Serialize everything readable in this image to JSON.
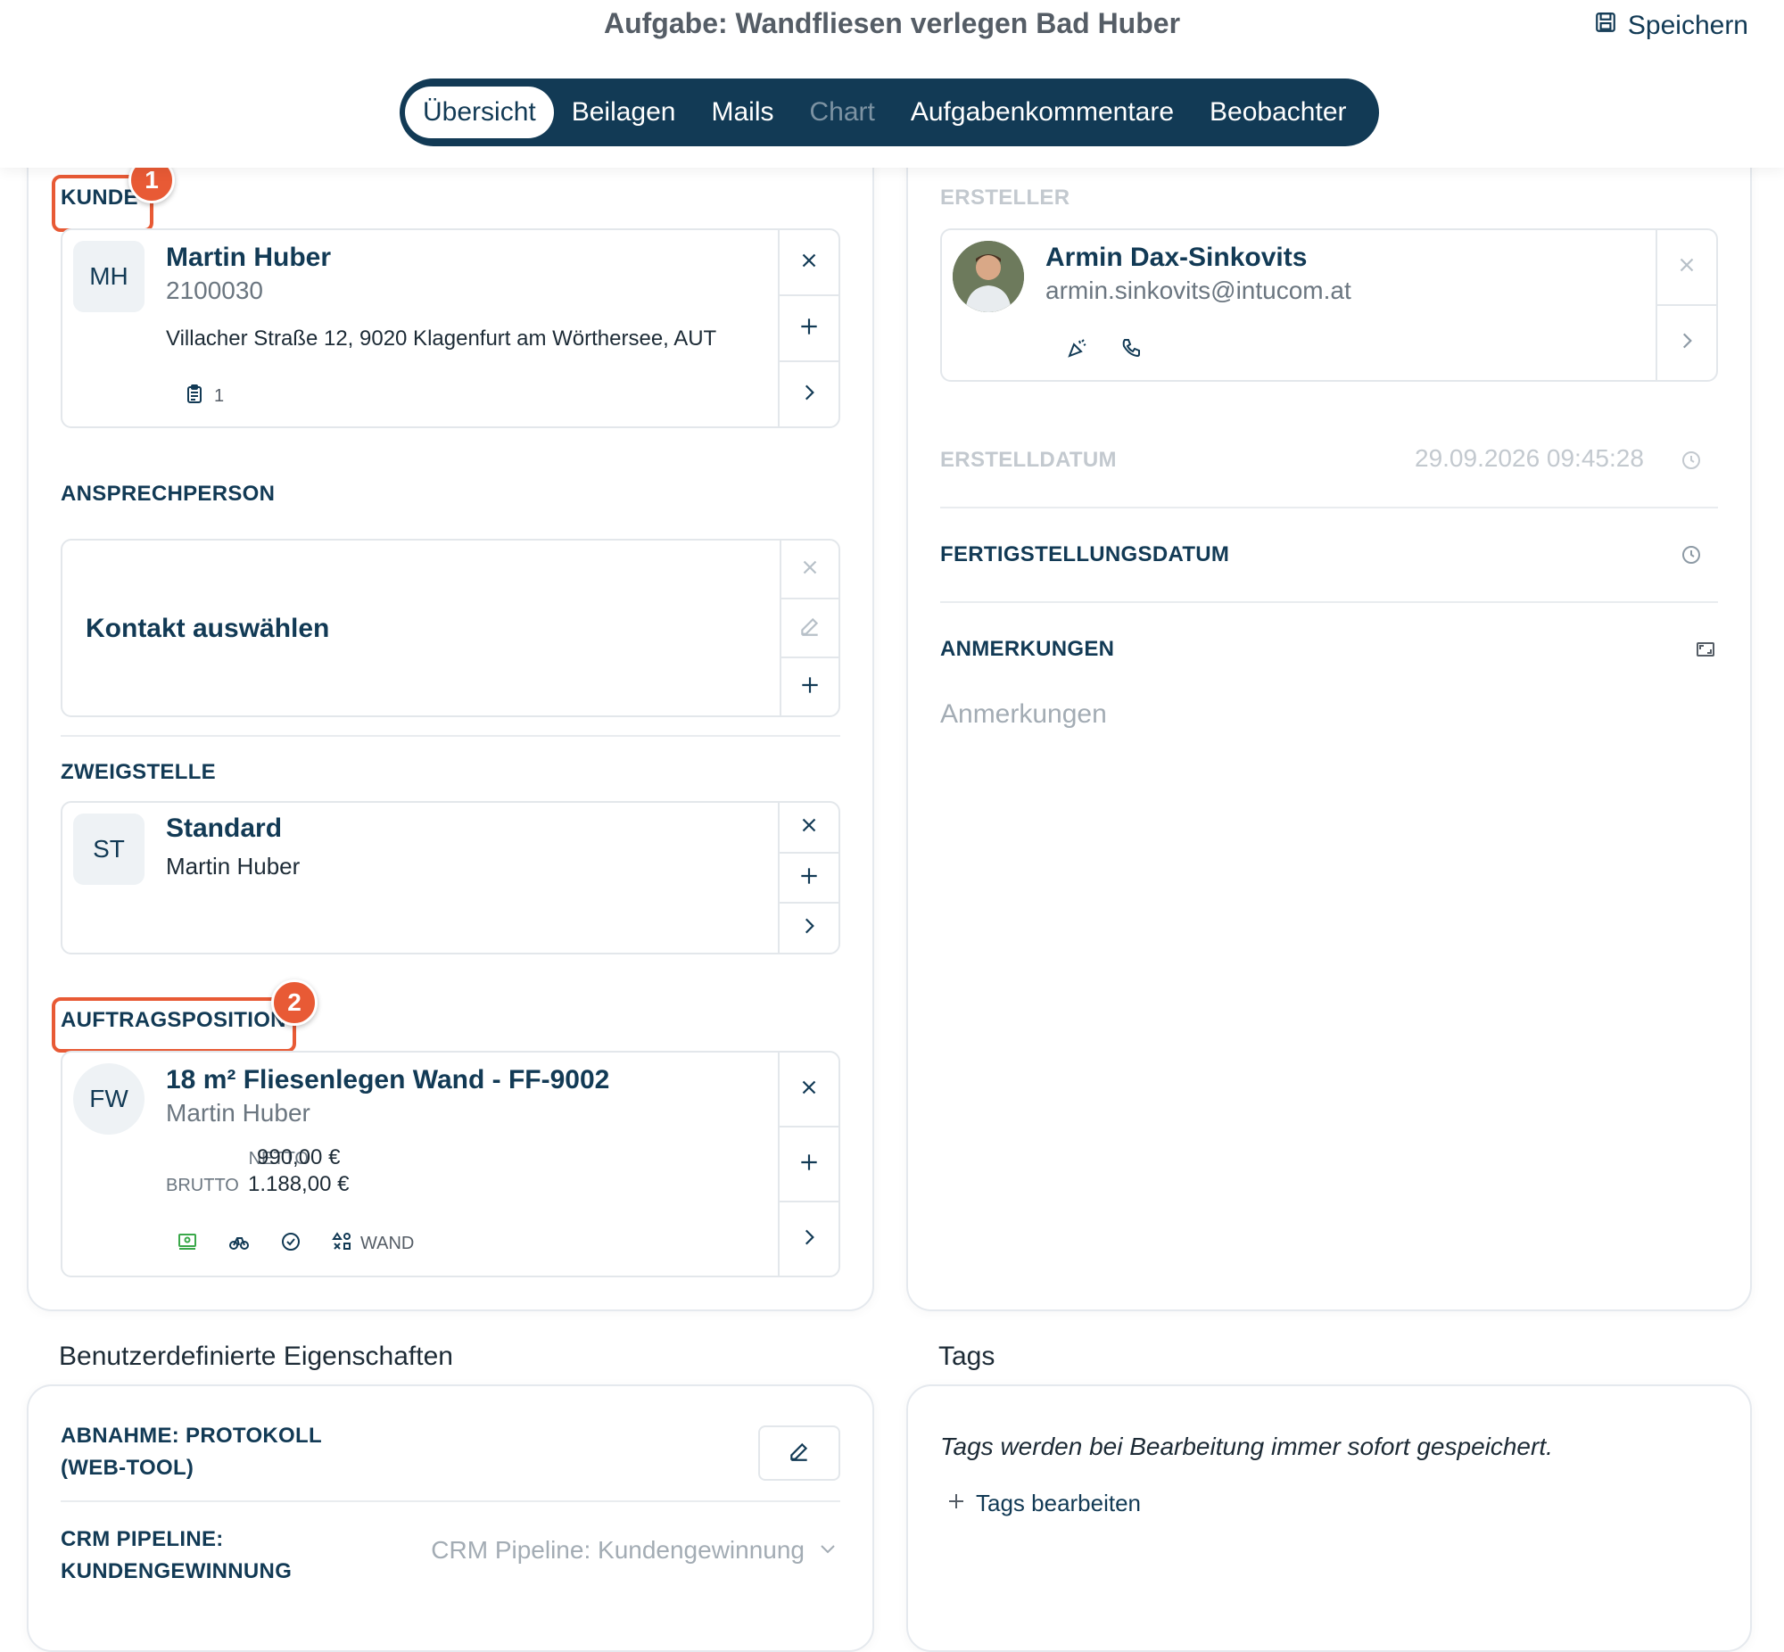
{
  "header": {
    "title": "Aufgabe: Wandfliesen verlegen Bad Huber",
    "save_label": "Speichern"
  },
  "tabs": [
    {
      "label": "Übersicht",
      "state": "active"
    },
    {
      "label": "Beilagen",
      "state": "normal"
    },
    {
      "label": "Mails",
      "state": "normal"
    },
    {
      "label": "Chart",
      "state": "disabled"
    },
    {
      "label": "Aufgabenkommentare",
      "state": "normal"
    },
    {
      "label": "Beobachter",
      "state": "normal"
    }
  ],
  "callouts": {
    "one": "1",
    "two": "2"
  },
  "kunde": {
    "label": "KUNDE",
    "initials": "MH",
    "name": "Martin Huber",
    "number": "2100030",
    "address": "Villacher Straße 12, 9020 Klagenfurt am Wörthersee, AUT",
    "doc_count": "1"
  },
  "ansprechperson": {
    "label": "ANSPRECHPERSON",
    "placeholder": "Kontakt auswählen"
  },
  "zweigstelle": {
    "label": "ZWEIGSTELLE",
    "initials": "ST",
    "name": "Standard",
    "sub": "Martin Huber"
  },
  "auftragsposition": {
    "label": "AUFTRAGSPOSITION",
    "initials": "FW",
    "name": "18 m² Fliesenlegen Wand - FF-9002",
    "sub": "Martin Huber",
    "netto_label": "NETTO",
    "netto_value": "990,00 €",
    "brutto_label": "BRUTTO",
    "brutto_value": "1.188,00 €",
    "category": "WAND"
  },
  "ersteller": {
    "label": "ERSTELLER",
    "name": "Armin Dax-Sinkovits",
    "email": "armin.sinkovits@intucom.at"
  },
  "erstelldatum": {
    "label": "ERSTELLDATUM",
    "value": "29.09.2026 09:45:28"
  },
  "fertigstellungsdatum": {
    "label": "FERTIGSTELLUNGSDATUM"
  },
  "anmerkungen": {
    "label": "ANMERKUNGEN",
    "placeholder": "Anmerkungen"
  },
  "custom_props": {
    "heading": "Benutzerdefinierte Eigenschaften",
    "abnahme_label_line1": "ABNAHME: PROTOKOLL",
    "abnahme_label_line2": "(WEB-TOOL)",
    "crm_label_line1": "CRM PIPELINE:",
    "crm_label_line2": "KUNDENGEWINNUNG",
    "crm_value": "CRM Pipeline: Kundengewinnung"
  },
  "tags": {
    "heading": "Tags",
    "info": "Tags werden bei Bearbeitung immer sofort gespeichert.",
    "edit_label": "Tags bearbeiten"
  },
  "colors": {
    "primary": "#123a55",
    "callout": "#e85a35",
    "green": "#3aa84a"
  }
}
